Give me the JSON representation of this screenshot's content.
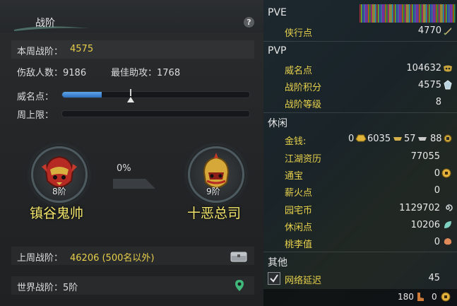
{
  "left": {
    "header": {
      "title": "战阶"
    },
    "weekly": {
      "label": "本周战阶：",
      "value": "4575"
    },
    "kills": "伤敌人数：9186",
    "assists": "最佳助攻：1768",
    "fame": {
      "label": "威名点：",
      "progress": 0.21,
      "marker": 0.37
    },
    "weekly_cap": {
      "label": "周上限：",
      "progress": 0
    },
    "current_rank": {
      "level": "8阶",
      "name": "镇谷鬼帅"
    },
    "next_rank": {
      "level": "9阶",
      "name": "十恶总司"
    },
    "progress_pct": "0%",
    "last_week": {
      "label": "上周战阶：",
      "value": "46206 (500名以外)"
    },
    "world": "世界战阶：5阶"
  },
  "right": {
    "pve": {
      "title": "PVE",
      "items": [
        {
          "label": "侠行点",
          "value": "4770"
        }
      ]
    },
    "pvp": {
      "title": "PVP",
      "items": [
        {
          "label": "威名点",
          "value": "104632"
        },
        {
          "label": "战阶积分",
          "value": "4575"
        },
        {
          "label": "战阶等级",
          "value": "8"
        }
      ]
    },
    "leisure": {
      "title": "休闲",
      "money": {
        "label": "金钱:",
        "gold": "0",
        "silver": "6035",
        "copper": "57",
        "small": "88"
      },
      "items": [
        {
          "label": "江湖资历",
          "value": "77055"
        },
        {
          "label": "通宝",
          "value": "0"
        },
        {
          "label": "薪火点",
          "value": "0"
        },
        {
          "label": "园宅币",
          "value": "1129702"
        },
        {
          "label": "休闲点",
          "value": "10206"
        },
        {
          "label": "桃李值",
          "value": "0"
        }
      ]
    },
    "other": {
      "title": "其他",
      "items": [
        {
          "label": "网络延迟",
          "value": "45"
        }
      ]
    },
    "footer": {
      "left": "180",
      "right": "0"
    }
  }
}
